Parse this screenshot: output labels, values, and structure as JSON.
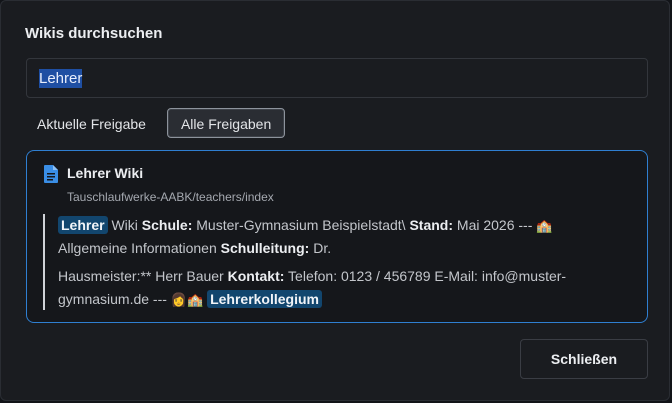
{
  "dialog": {
    "title": "Wikis durchsuchen",
    "search_value": "Lehrer",
    "tabs": [
      {
        "label": "Aktuelle Freigabe",
        "active": false
      },
      {
        "label": "Alle Freigaben",
        "active": true
      }
    ],
    "close_label": "Schließen"
  },
  "result": {
    "icon": "document-icon",
    "title": "Lehrer Wiki",
    "path": "Tauschlaufwerke-AABK/teachers/index",
    "line1": {
      "hl1": "Lehrer",
      "t1": " Wiki ",
      "b1": "Schule:",
      "t2": " Muster-Gymnasium Beispielstadt\\ ",
      "b2": "Stand:",
      "t3": " Mai 2026 --- ",
      "e1": "🏫",
      "t4": " Allgemeine Informationen ",
      "b3": "Schulleitung:",
      "t5": " Dr."
    },
    "line2": {
      "t1": "Hausmeister:** Herr Bauer ",
      "b1": "Kontakt:",
      "t2": " Telefon: 0123 / 456789 E-Mail: info@muster-gymnasium.de --- ",
      "e1": "👩🏫",
      "hl1": "Lehrerkollegium"
    }
  },
  "colors": {
    "accent": "#2f7fd1",
    "highlight": "#12466e",
    "selection": "#1f4fa3",
    "background": "#1a1c20"
  }
}
